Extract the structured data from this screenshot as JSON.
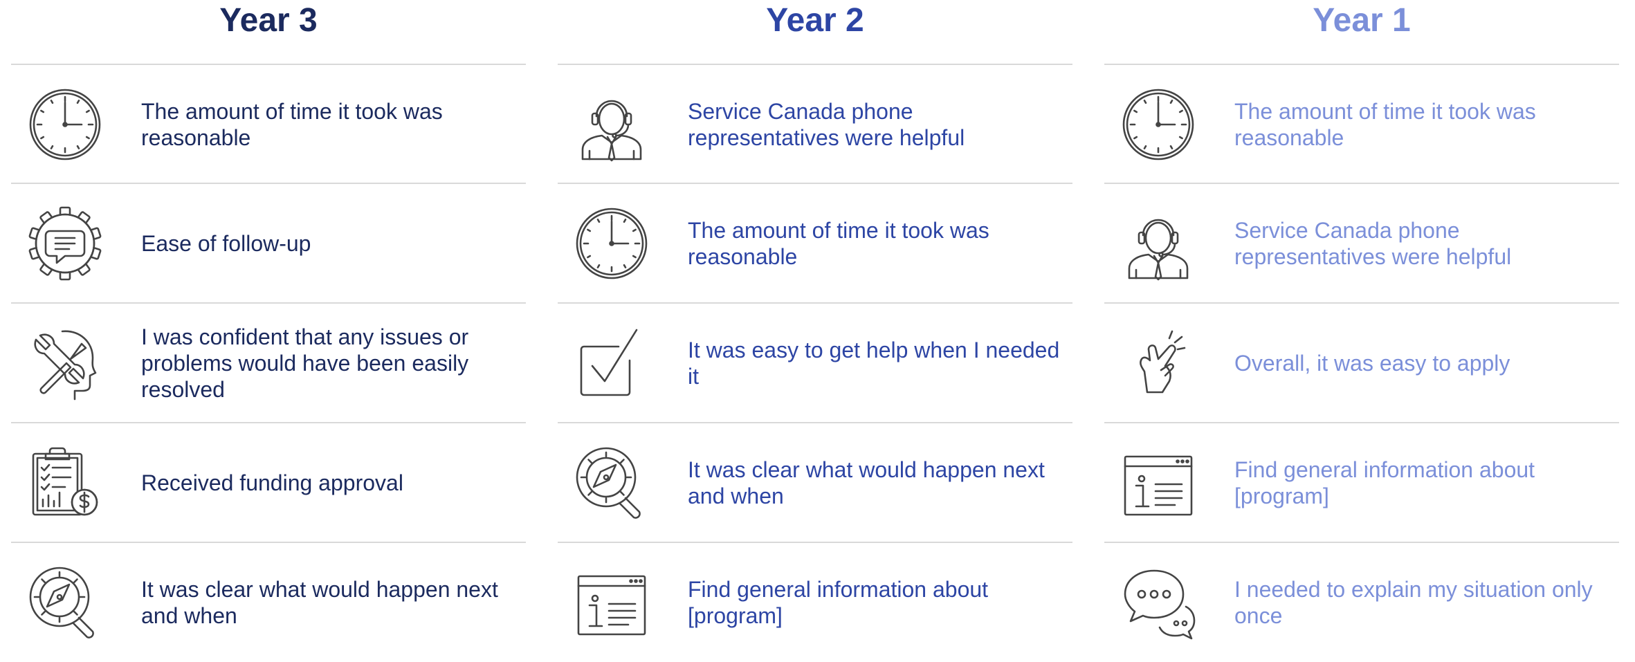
{
  "columns": [
    {
      "heading": "Year 3",
      "color": "#1b2a5e",
      "items": [
        {
          "icon": "clock-icon",
          "text": "The amount of time it took was reasonable"
        },
        {
          "icon": "gear-chat-icon",
          "text": "Ease of follow-up"
        },
        {
          "icon": "head-tools-icon",
          "text": "I was confident that any issues or problems would have been easily resolved"
        },
        {
          "icon": "clipboard-dollar-icon",
          "text": "Received funding approval"
        },
        {
          "icon": "compass-magnifier-icon",
          "text": "It was clear what would happen next and when"
        }
      ]
    },
    {
      "heading": "Year 2",
      "color": "#2d45a4",
      "items": [
        {
          "icon": "headset-agent-icon",
          "text": "Service Canada phone representatives were helpful"
        },
        {
          "icon": "clock-icon",
          "text": "The amount of time it took was reasonable"
        },
        {
          "icon": "checkbox-icon",
          "text": "It was easy to get help when I needed it"
        },
        {
          "icon": "compass-magnifier-icon",
          "text": "It was clear what would happen next and when"
        },
        {
          "icon": "info-window-icon",
          "text": "Find general information about [program]"
        }
      ]
    },
    {
      "heading": "Year 1",
      "color": "#7b8fd9",
      "items": [
        {
          "icon": "clock-icon",
          "text": "The amount of time it took was reasonable"
        },
        {
          "icon": "headset-agent-icon",
          "text": "Service Canada phone representatives were helpful"
        },
        {
          "icon": "finger-snap-icon",
          "text": "Overall, it was easy to apply"
        },
        {
          "icon": "info-window-icon",
          "text": "Find general information about [program]"
        },
        {
          "icon": "speech-bubbles-icon",
          "text": "I needed to explain my situation only once"
        }
      ]
    }
  ]
}
